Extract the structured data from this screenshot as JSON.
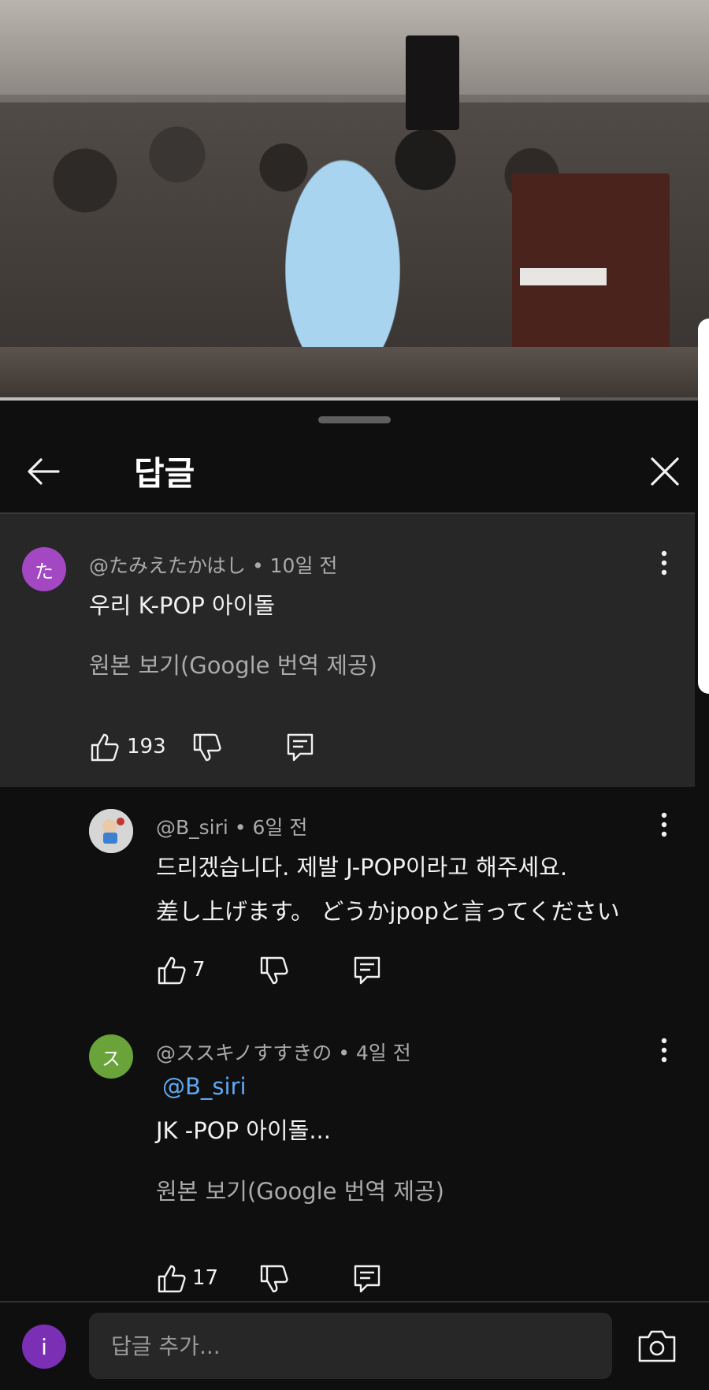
{
  "video": {
    "progress_fraction": 0.79
  },
  "sheet": {
    "title": "답글",
    "back_icon": "arrow-left-icon",
    "close_icon": "close-icon"
  },
  "comments": [
    {
      "author": "@たみえたかはし",
      "time": "10일 전",
      "avatar_letter": "た",
      "avatar_color": "#a347c3",
      "text": "우리 K-POP 아이돌",
      "translate_link": "원본 보기(Google 번역 제공)",
      "likes": "193"
    },
    {
      "author": "@B_siri",
      "time": "6일 전",
      "avatar_letter": "",
      "avatar_color": "#d9d9d9",
      "text_line1": "드리겠습니다. 제발 J-POP이라고 해주세요.",
      "text_line2": "差し上げます。 どうかjpopと言ってください",
      "likes": "7"
    },
    {
      "author": "@ススキノすすきの",
      "time": "4일 전",
      "avatar_letter": "ス",
      "avatar_color": "#69a33a",
      "mention": "@B_siri",
      "text": "JK -POP 아이돌...",
      "translate_link": "원본 보기(Google 번역 제공)",
      "likes": "17"
    }
  ],
  "composer": {
    "avatar_letter": "i",
    "avatar_color": "#7b2fb5",
    "placeholder": "답글 추가...",
    "camera_icon": "camera-icon"
  },
  "colors": {
    "background": "#0f0f0f",
    "highlight": "#272727",
    "mention": "#5fa8ef"
  }
}
